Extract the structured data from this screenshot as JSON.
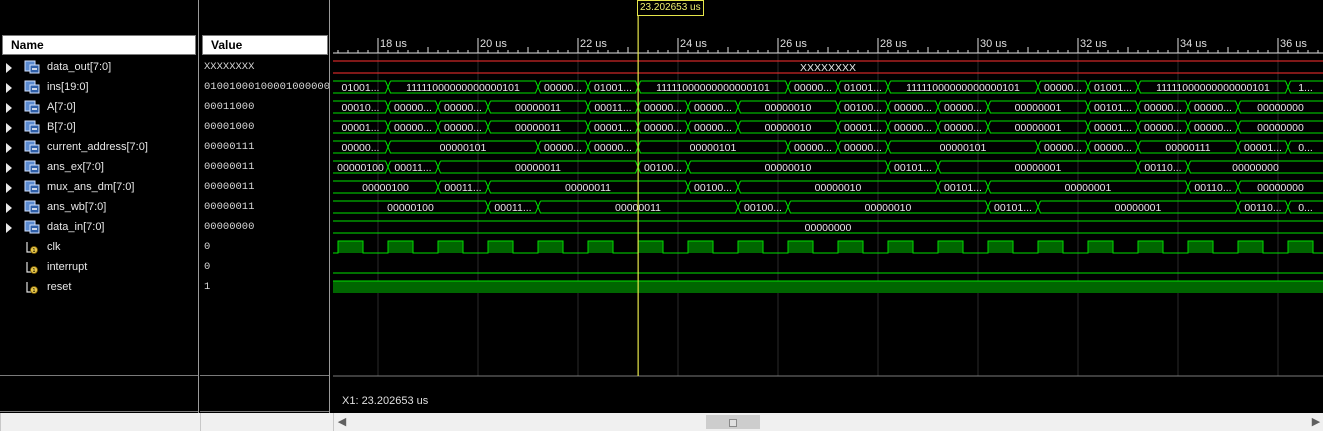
{
  "name_header": "Name",
  "value_header": "Value",
  "cursor": {
    "time_us": 23.202653,
    "label": "23.202653 us",
    "readout": "X1: 23.202653 us"
  },
  "timeline": {
    "start_us": 17.1,
    "end_us": 36.9,
    "ticks": [
      {
        "t": 18,
        "label": "18 us"
      },
      {
        "t": 20,
        "label": "20 us"
      },
      {
        "t": 22,
        "label": "22 us"
      },
      {
        "t": 24,
        "label": "24 us"
      },
      {
        "t": 26,
        "label": "26 us"
      },
      {
        "t": 28,
        "label": "28 us"
      },
      {
        "t": 30,
        "label": "30 us"
      },
      {
        "t": 32,
        "label": "32 us"
      },
      {
        "t": 34,
        "label": "34 us"
      },
      {
        "t": 36,
        "label": "36 us"
      }
    ]
  },
  "colors": {
    "bus": "#00e000",
    "bus_red": "#ff3030",
    "wave_fill": "#006600",
    "text": "#e8e8e8",
    "cursor": "#e6e64a"
  },
  "signals": [
    {
      "name": "data_out[7:0]",
      "value": "XXXXXXXX",
      "type": "bus",
      "red": true,
      "segments": [
        {
          "start": 17.1,
          "label": "XXXXXXXX"
        }
      ]
    },
    {
      "name": "ins[19:0]",
      "value": "01001000100001000000",
      "type": "bus",
      "segments": [
        {
          "start": 17.1,
          "label": "01001..."
        },
        {
          "start": 18.2,
          "label": "11111000000000000101"
        },
        {
          "start": 21.2,
          "label": "00000..."
        },
        {
          "start": 22.2,
          "label": "01001..."
        },
        {
          "start": 23.2,
          "label": "11111000000000000101"
        },
        {
          "start": 26.2,
          "label": "00000..."
        },
        {
          "start": 27.2,
          "label": "01001..."
        },
        {
          "start": 28.2,
          "label": "11111000000000000101"
        },
        {
          "start": 31.2,
          "label": "00000..."
        },
        {
          "start": 32.2,
          "label": "01001..."
        },
        {
          "start": 33.2,
          "label": "11111000000000000101"
        },
        {
          "start": 36.2,
          "label": "1..."
        }
      ]
    },
    {
      "name": "A[7:0]",
      "value": "00011000",
      "type": "bus",
      "segments": [
        {
          "start": 17.1,
          "label": "00010..."
        },
        {
          "start": 18.2,
          "label": "00000..."
        },
        {
          "start": 19.2,
          "label": "00000..."
        },
        {
          "start": 20.2,
          "label": "00000011"
        },
        {
          "start": 22.2,
          "label": "00011..."
        },
        {
          "start": 23.2,
          "label": "00000..."
        },
        {
          "start": 24.2,
          "label": "00000..."
        },
        {
          "start": 25.2,
          "label": "00000010"
        },
        {
          "start": 27.2,
          "label": "00100..."
        },
        {
          "start": 28.2,
          "label": "00000..."
        },
        {
          "start": 29.2,
          "label": "00000..."
        },
        {
          "start": 30.2,
          "label": "00000001"
        },
        {
          "start": 32.2,
          "label": "00101..."
        },
        {
          "start": 33.2,
          "label": "00000..."
        },
        {
          "start": 34.2,
          "label": "00000..."
        },
        {
          "start": 35.2,
          "label": "00000000"
        }
      ]
    },
    {
      "name": "B[7:0]",
      "value": "00001000",
      "type": "bus",
      "segments": [
        {
          "start": 17.1,
          "label": "00001..."
        },
        {
          "start": 18.2,
          "label": "00000..."
        },
        {
          "start": 19.2,
          "label": "00000..."
        },
        {
          "start": 20.2,
          "label": "00000011"
        },
        {
          "start": 22.2,
          "label": "00001..."
        },
        {
          "start": 23.2,
          "label": "00000..."
        },
        {
          "start": 24.2,
          "label": "00000..."
        },
        {
          "start": 25.2,
          "label": "00000010"
        },
        {
          "start": 27.2,
          "label": "00001..."
        },
        {
          "start": 28.2,
          "label": "00000..."
        },
        {
          "start": 29.2,
          "label": "00000..."
        },
        {
          "start": 30.2,
          "label": "00000001"
        },
        {
          "start": 32.2,
          "label": "00001..."
        },
        {
          "start": 33.2,
          "label": "00000..."
        },
        {
          "start": 34.2,
          "label": "00000..."
        },
        {
          "start": 35.2,
          "label": "00000000"
        }
      ]
    },
    {
      "name": "current_address[7:0]",
      "value": "00000111",
      "type": "bus",
      "segments": [
        {
          "start": 17.1,
          "label": "00000..."
        },
        {
          "start": 18.2,
          "label": "00000101"
        },
        {
          "start": 21.2,
          "label": "00000..."
        },
        {
          "start": 22.2,
          "label": "00000..."
        },
        {
          "start": 23.2,
          "label": "00000101"
        },
        {
          "start": 26.2,
          "label": "00000..."
        },
        {
          "start": 27.2,
          "label": "00000..."
        },
        {
          "start": 28.2,
          "label": "00000101"
        },
        {
          "start": 31.2,
          "label": "00000..."
        },
        {
          "start": 32.2,
          "label": "00000..."
        },
        {
          "start": 33.2,
          "label": "00000111"
        },
        {
          "start": 35.2,
          "label": "00001..."
        },
        {
          "start": 36.2,
          "label": "0..."
        }
      ]
    },
    {
      "name": "ans_ex[7:0]",
      "value": "00000011",
      "type": "bus",
      "segments": [
        {
          "start": 17.1,
          "label": "00000100"
        },
        {
          "start": 18.2,
          "label": "00011..."
        },
        {
          "start": 19.2,
          "label": "00000011"
        },
        {
          "start": 23.2,
          "label": "00100..."
        },
        {
          "start": 24.2,
          "label": "00000010"
        },
        {
          "start": 28.2,
          "label": "00101..."
        },
        {
          "start": 29.2,
          "label": "00000001"
        },
        {
          "start": 33.2,
          "label": "00110..."
        },
        {
          "start": 34.2,
          "label": "00000000"
        }
      ]
    },
    {
      "name": "mux_ans_dm[7:0]",
      "value": "00000011",
      "type": "bus",
      "segments": [
        {
          "start": 17.1,
          "label": "00000100"
        },
        {
          "start": 19.2,
          "label": "00011..."
        },
        {
          "start": 20.2,
          "label": "00000011"
        },
        {
          "start": 24.2,
          "label": "00100..."
        },
        {
          "start": 25.2,
          "label": "00000010"
        },
        {
          "start": 29.2,
          "label": "00101..."
        },
        {
          "start": 30.2,
          "label": "00000001"
        },
        {
          "start": 34.2,
          "label": "00110..."
        },
        {
          "start": 35.2,
          "label": "00000000"
        }
      ]
    },
    {
      "name": "ans_wb[7:0]",
      "value": "00000011",
      "type": "bus",
      "segments": [
        {
          "start": 17.1,
          "label": "00000100"
        },
        {
          "start": 20.2,
          "label": "00011..."
        },
        {
          "start": 21.2,
          "label": "00000011"
        },
        {
          "start": 25.2,
          "label": "00100..."
        },
        {
          "start": 26.2,
          "label": "00000010"
        },
        {
          "start": 30.2,
          "label": "00101..."
        },
        {
          "start": 31.2,
          "label": "00000001"
        },
        {
          "start": 35.2,
          "label": "00110..."
        },
        {
          "start": 36.2,
          "label": "0..."
        }
      ]
    },
    {
      "name": "data_in[7:0]",
      "value": "00000000",
      "type": "bus",
      "segments": [
        {
          "start": 17.1,
          "label": "00000000"
        }
      ]
    },
    {
      "name": "clk",
      "value": "0",
      "type": "clock",
      "period_us": 1.0,
      "first_rise_us": 17.2
    },
    {
      "name": "interrupt",
      "value": "0",
      "type": "bit",
      "level": 0
    },
    {
      "name": "reset",
      "value": "1",
      "type": "bit",
      "level": 1
    }
  ],
  "scrollbar": {
    "thumb_start": 0.372,
    "thumb_end": 0.428
  }
}
